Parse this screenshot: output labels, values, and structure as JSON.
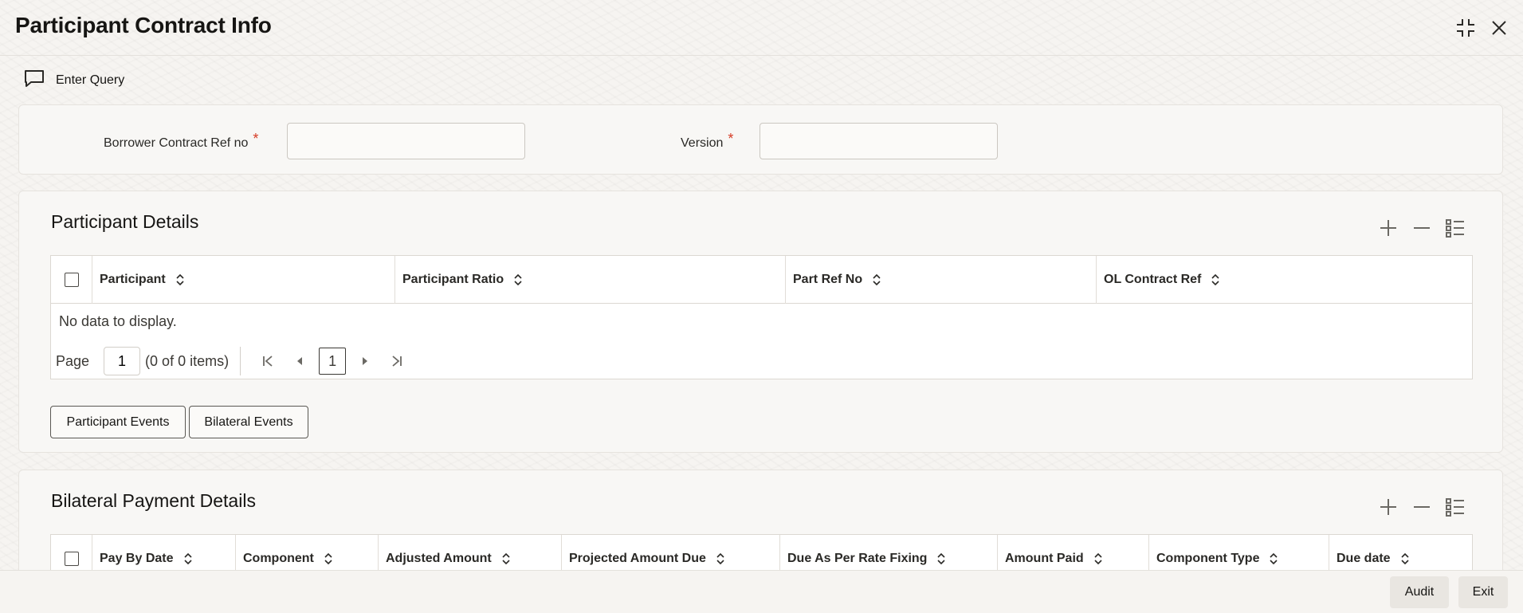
{
  "window": {
    "title": "Participant Contract Info",
    "maximize_icon": "compress-icon",
    "close_icon": "close-icon"
  },
  "toolbar": {
    "enter_query_label": "Enter Query",
    "enter_query_icon": "chat-bubble-icon"
  },
  "query": {
    "borrower_ref_label": "Borrower Contract Ref no",
    "borrower_ref_value": "",
    "version_label": "Version",
    "version_value": "",
    "required_mark": "*"
  },
  "participant_details": {
    "title": "Participant Details",
    "columns": [
      "Participant",
      "Participant Ratio",
      "Part Ref No",
      "OL Contract Ref"
    ],
    "empty_text": "No data to display.",
    "pager": {
      "page_label": "Page",
      "page_value": "1",
      "items_text": "(0 of 0 items)",
      "current_page": "1"
    },
    "buttons": {
      "participant_events": "Participant Events",
      "bilateral_events": "Bilateral Events"
    }
  },
  "bilateral_payment_details": {
    "title": "Bilateral Payment Details",
    "columns": [
      "Pay By Date",
      "Component",
      "Adjusted Amount",
      "Projected Amount Due",
      "Due As Per Rate Fixing",
      "Amount Paid",
      "Component Type",
      "Due date"
    ]
  },
  "footer": {
    "audit_label": "Audit",
    "exit_label": "Exit"
  },
  "colors": {
    "required": "#d63b25",
    "text": "#161513",
    "panel": "#f8f7f5"
  }
}
